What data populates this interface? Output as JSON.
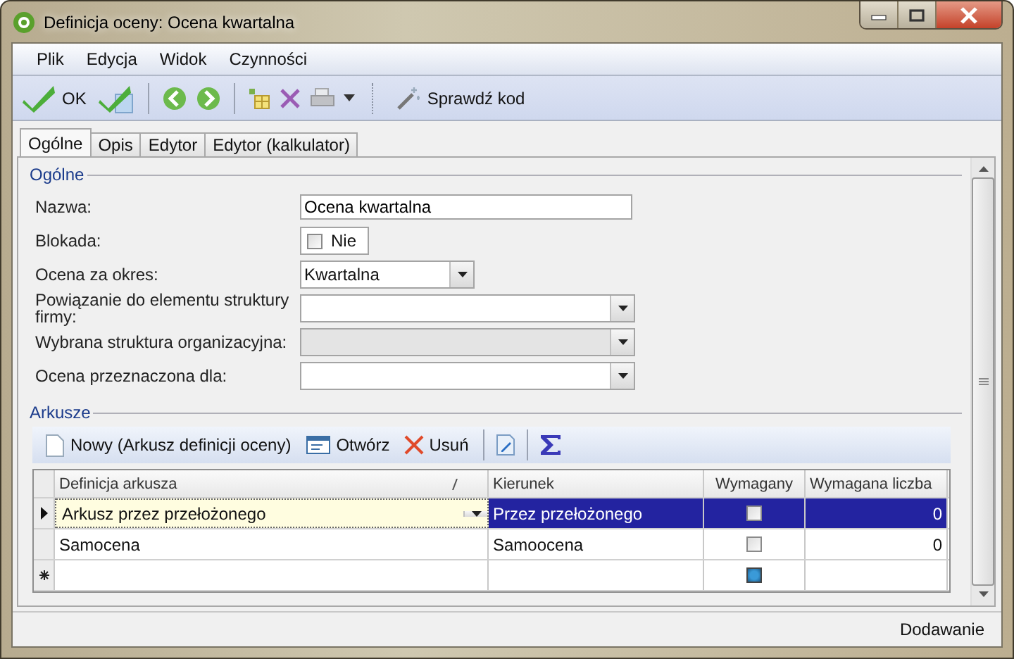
{
  "window": {
    "title": "Definicja oceny: Ocena kwartalna"
  },
  "menu": [
    {
      "label": "Plik"
    },
    {
      "label": "Edycja"
    },
    {
      "label": "Widok"
    },
    {
      "label": "Czynności"
    }
  ],
  "toolbar": {
    "ok": "OK",
    "check_code": "Sprawdź kod"
  },
  "tabs": [
    {
      "label": "Ogólne",
      "selected": true
    },
    {
      "label": "Opis",
      "selected": false
    },
    {
      "label": "Edytor",
      "selected": false
    },
    {
      "label": "Edytor (kalkulator)",
      "selected": false
    }
  ],
  "general": {
    "title": "Ogólne",
    "fields": [
      {
        "kind": "text",
        "label": "Nazwa:",
        "value": "Ocena kwartalna"
      },
      {
        "kind": "checkbox",
        "label": "Blokada:",
        "checked": false,
        "text": "Nie"
      },
      {
        "kind": "short-combo",
        "label": "Ocena za okres:",
        "value": "Kwartalna",
        "disabled": false
      },
      {
        "kind": "combo",
        "label": "Powiązanie do elementu struktury firmy:",
        "disabled": false
      },
      {
        "kind": "combo",
        "label": "Wybrana struktura organizacyjna:",
        "disabled": true
      },
      {
        "kind": "combo",
        "label": "Ocena przeznaczona dla:",
        "disabled": false
      }
    ]
  },
  "sheets": {
    "title": "Arkusze",
    "actions": {
      "new": "Nowy (Arkusz definicji oceny)",
      "open": "Otwórz",
      "delete": "Usuń"
    },
    "columns": [
      "Definicja arkusza",
      "Kierunek",
      "Wymagany",
      "Wymagana liczba"
    ],
    "rows": [
      {
        "kind": "data",
        "definition": "Arkusz przez przełożonego",
        "direction": "Przez przełożonego",
        "required": false,
        "indeterminate": false,
        "count": "0",
        "selected": true
      },
      {
        "kind": "data",
        "definition": "Samocena",
        "direction": "Samoocena",
        "required": false,
        "indeterminate": false,
        "count": "0",
        "selected": false
      },
      {
        "kind": "new",
        "indeterminate": true,
        "selected": false
      }
    ]
  },
  "status_bar": "Dodawanie"
}
